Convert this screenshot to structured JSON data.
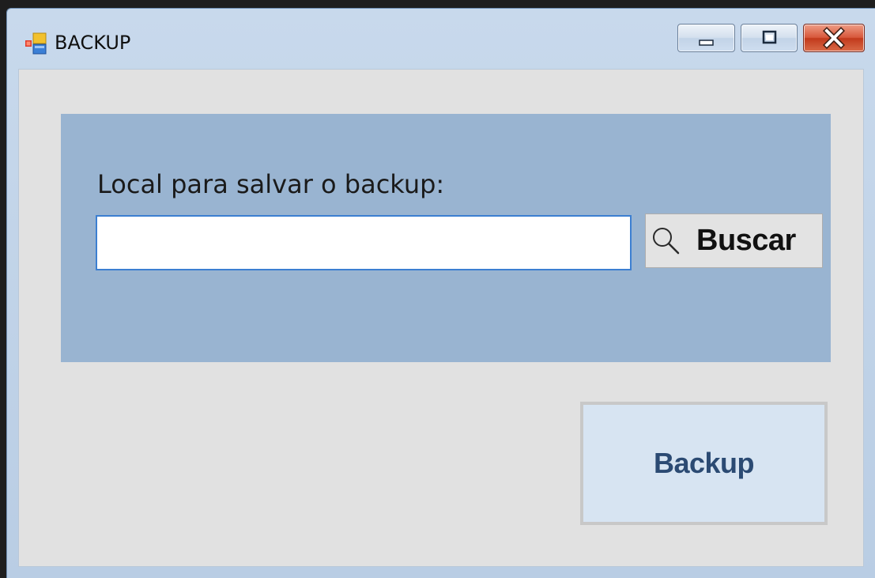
{
  "window": {
    "title": "BACKUP",
    "app_icon": "form-icon",
    "controls": {
      "minimize_icon": "minimize-icon",
      "maximize_icon": "maximize-icon",
      "close_icon": "close-icon"
    }
  },
  "form": {
    "label": "Local para salvar o backup:",
    "path_input": {
      "value": "",
      "placeholder": ""
    },
    "browse_button": {
      "icon": "search-icon",
      "label": "Buscar"
    },
    "backup_button": {
      "label": "Backup"
    }
  },
  "colors": {
    "panel": "#99b4d1",
    "client": "#e1e1e1",
    "backup_button_bg": "#d7e4f2",
    "backup_button_text": "#2b4a73",
    "close_button": "#c94a2c"
  }
}
